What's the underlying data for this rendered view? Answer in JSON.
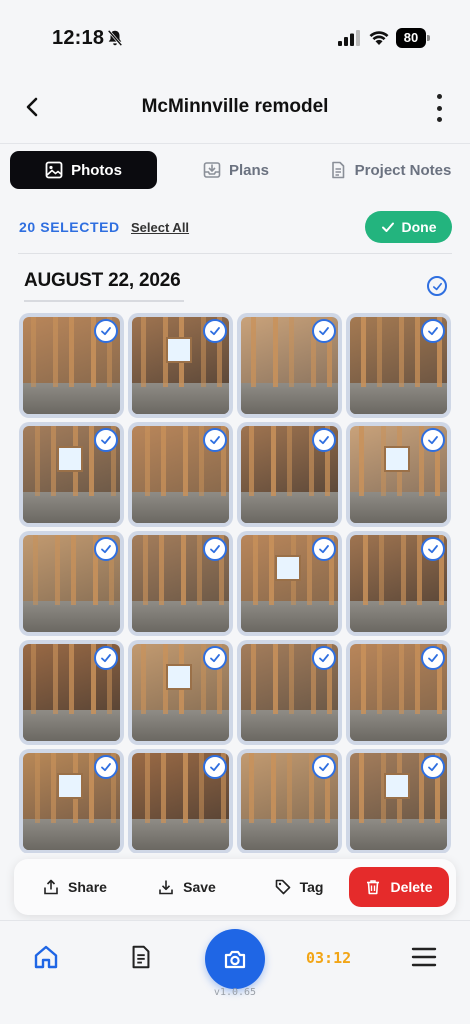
{
  "status_bar": {
    "time": "12:18",
    "battery": "80"
  },
  "header": {
    "title": "McMinnville remodel"
  },
  "tabs": [
    {
      "label": "Photos",
      "active": true,
      "icon": "image-icon"
    },
    {
      "label": "Plans",
      "active": false,
      "icon": "tray-icon"
    },
    {
      "label": "Project Notes",
      "active": false,
      "icon": "document-icon"
    }
  ],
  "selection": {
    "count_label": "20 SELECTED",
    "select_all": "Select All",
    "done": "Done"
  },
  "section": {
    "date": "AUGUST 22, 2026"
  },
  "photos": [
    {
      "selected": true
    },
    {
      "selected": true
    },
    {
      "selected": true
    },
    {
      "selected": true
    },
    {
      "selected": true
    },
    {
      "selected": true
    },
    {
      "selected": true
    },
    {
      "selected": true
    },
    {
      "selected": true
    },
    {
      "selected": true
    },
    {
      "selected": true
    },
    {
      "selected": true
    },
    {
      "selected": true
    },
    {
      "selected": true
    },
    {
      "selected": true
    },
    {
      "selected": true
    },
    {
      "selected": true
    },
    {
      "selected": true
    },
    {
      "selected": true
    },
    {
      "selected": true
    }
  ],
  "actions": {
    "share": "Share",
    "save": "Save",
    "tag": "Tag",
    "delete": "Delete"
  },
  "bottom_nav": {
    "timer": "03:12",
    "version": "v1.0.65"
  },
  "colors": {
    "accent_blue": "#2f6fe0",
    "done_green": "#23b47e",
    "delete_red": "#e52b2b",
    "timer_orange": "#f2a516"
  }
}
